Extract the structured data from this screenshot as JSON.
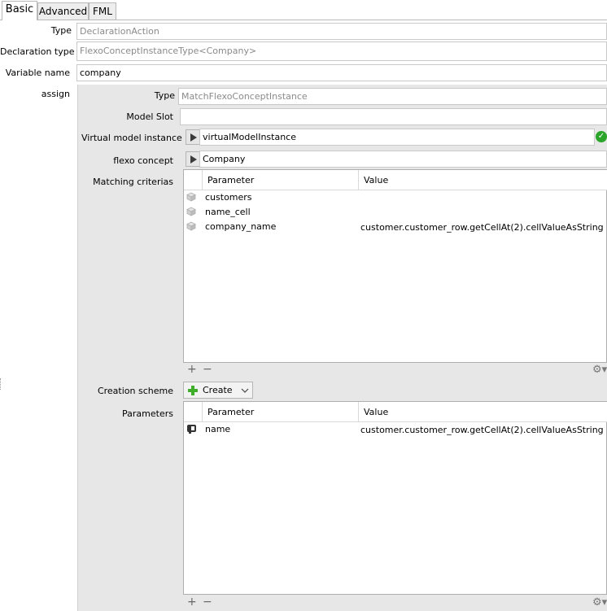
{
  "tabs": [
    {
      "label": "Basic"
    },
    {
      "label": "Advanced"
    },
    {
      "label": "FML"
    }
  ],
  "form": {
    "type_label": "Type",
    "type_value": "DeclarationAction",
    "declaration_type_label": "Declaration type",
    "declaration_type_value": "FlexoConceptInstanceType<Company>",
    "variable_name_label": "Variable name",
    "variable_name_value": "company",
    "assign_label": "assign"
  },
  "assign": {
    "type_label": "Type",
    "type_value": "MatchFlexoConceptInstance",
    "model_slot_label": "Model Slot",
    "model_slot_value": "",
    "virtual_model_instance_label": "Virtual model instance",
    "virtual_model_instance_value": "virtualModelInstance",
    "flexo_concept_label": "flexo concept",
    "flexo_concept_value": "Company",
    "matching_criterias_label": "Matching criterias",
    "creation_scheme_label": "Creation scheme",
    "creation_scheme_value": "Create",
    "parameters_label": "Parameters"
  },
  "matching_table": {
    "headers": [
      "Parameter",
      "Value"
    ],
    "rows": [
      {
        "parameter": "customers",
        "value": ""
      },
      {
        "parameter": "name_cell",
        "value": ""
      },
      {
        "parameter": "company_name",
        "value": "customer.customer_row.getCellAt(2).cellValueAsString"
      }
    ]
  },
  "parameters_table": {
    "headers": [
      "Parameter",
      "Value"
    ],
    "rows": [
      {
        "parameter": "name",
        "value": "customer.customer_row.getCellAt(2).cellValueAsString"
      }
    ]
  },
  "controls": {
    "add_symbol": "+",
    "remove_symbol": "−",
    "gear_symbol": "⚙▾",
    "check_symbol": "✓"
  },
  "colors": {
    "panel_bg": "#e7e7e7",
    "valid_green": "#2aa52a",
    "readonly_text": "#8a8a8a"
  }
}
